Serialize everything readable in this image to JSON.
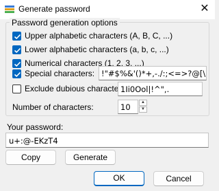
{
  "window": {
    "title": "Generate password",
    "close_glyph": "✕"
  },
  "options": {
    "group_label": "Password generation options",
    "upper": {
      "label": "Upper alphabetic characters (A, B, C, ...)",
      "checked": true
    },
    "lower": {
      "label": "Lower alphabetic characters (a, b, c, ...)",
      "checked": true
    },
    "numeric": {
      "label": "Numerical characters (1, 2, 3, ...)",
      "checked": true
    },
    "special": {
      "label": "Special characters:",
      "checked": true,
      "value": "!\"#$%&'()*+,-./:;<=>?@[\\]^_`{"
    },
    "exclude": {
      "label": "Exclude dubious characters:",
      "checked": false,
      "value": "1Ii0Ool|!^\",."
    },
    "count": {
      "label": "Number of characters:",
      "value": "10"
    }
  },
  "password": {
    "label": "Your password:",
    "value": "u+:@-EKzT4"
  },
  "buttons": {
    "copy": "Copy",
    "generate": "Generate",
    "ok": "OK",
    "cancel": "Cancel"
  },
  "icons": {
    "app": "keepass-icon",
    "close": "close-icon",
    "check": "checkmark-icon"
  },
  "colors": {
    "accent": "#0067c0"
  }
}
